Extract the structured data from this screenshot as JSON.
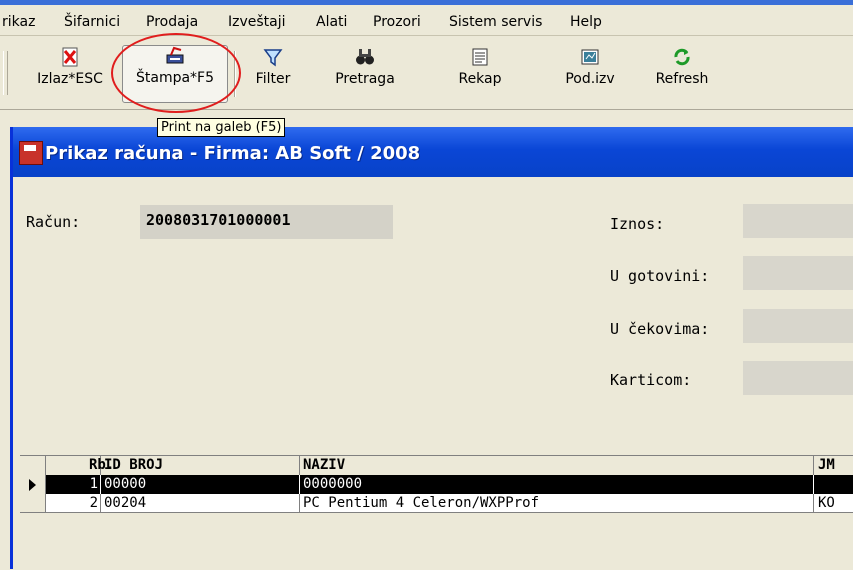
{
  "menu": [
    "rikaz",
    "Šifarnici",
    "Prodaja",
    "Izveštaji",
    "Alati",
    "Prozori",
    "Sistem servis",
    "Help"
  ],
  "toolbar": {
    "buttons": [
      {
        "label": "Izlaz*ESC",
        "icon": "close-x-icon"
      },
      {
        "label": "Štampa*F5",
        "icon": "print-icon"
      },
      {
        "label": "Filter",
        "icon": "filter-icon"
      },
      {
        "label": "Pretraga",
        "icon": "binoculars-icon"
      },
      {
        "label": "Rekap",
        "icon": "recap-icon"
      },
      {
        "label": "Pod.izv",
        "icon": "report-icon"
      },
      {
        "label": "Refresh",
        "icon": "refresh-icon"
      }
    ],
    "tooltip": "Print na galeb (F5)"
  },
  "window": {
    "title": "Prikaz računa  - Firma:  AB Soft / 2008",
    "fields": {
      "racun_label": "Račun:",
      "racun_value": "2008031701000001",
      "iznos_label": "Iznos:",
      "gotovina_label": "U gotovini:",
      "cekovi_label": "U čekovima:",
      "kartica_label": "Karticom:"
    },
    "grid": {
      "headers": [
        "Rb.",
        "ID BROJ",
        "NAZIV",
        "JM"
      ],
      "rows": [
        {
          "rb": "1",
          "id": "00000",
          "naziv": "0000000",
          "jm": ""
        },
        {
          "rb": "2",
          "id": "00204",
          "naziv": "PC Pentium 4 Celeron/WXPProf",
          "jm": "KO"
        }
      ]
    }
  },
  "colors": {
    "title_blue": "#0a46d6",
    "highlight_red": "#e01d1d",
    "tooltip_bg": "#ffffe1"
  }
}
